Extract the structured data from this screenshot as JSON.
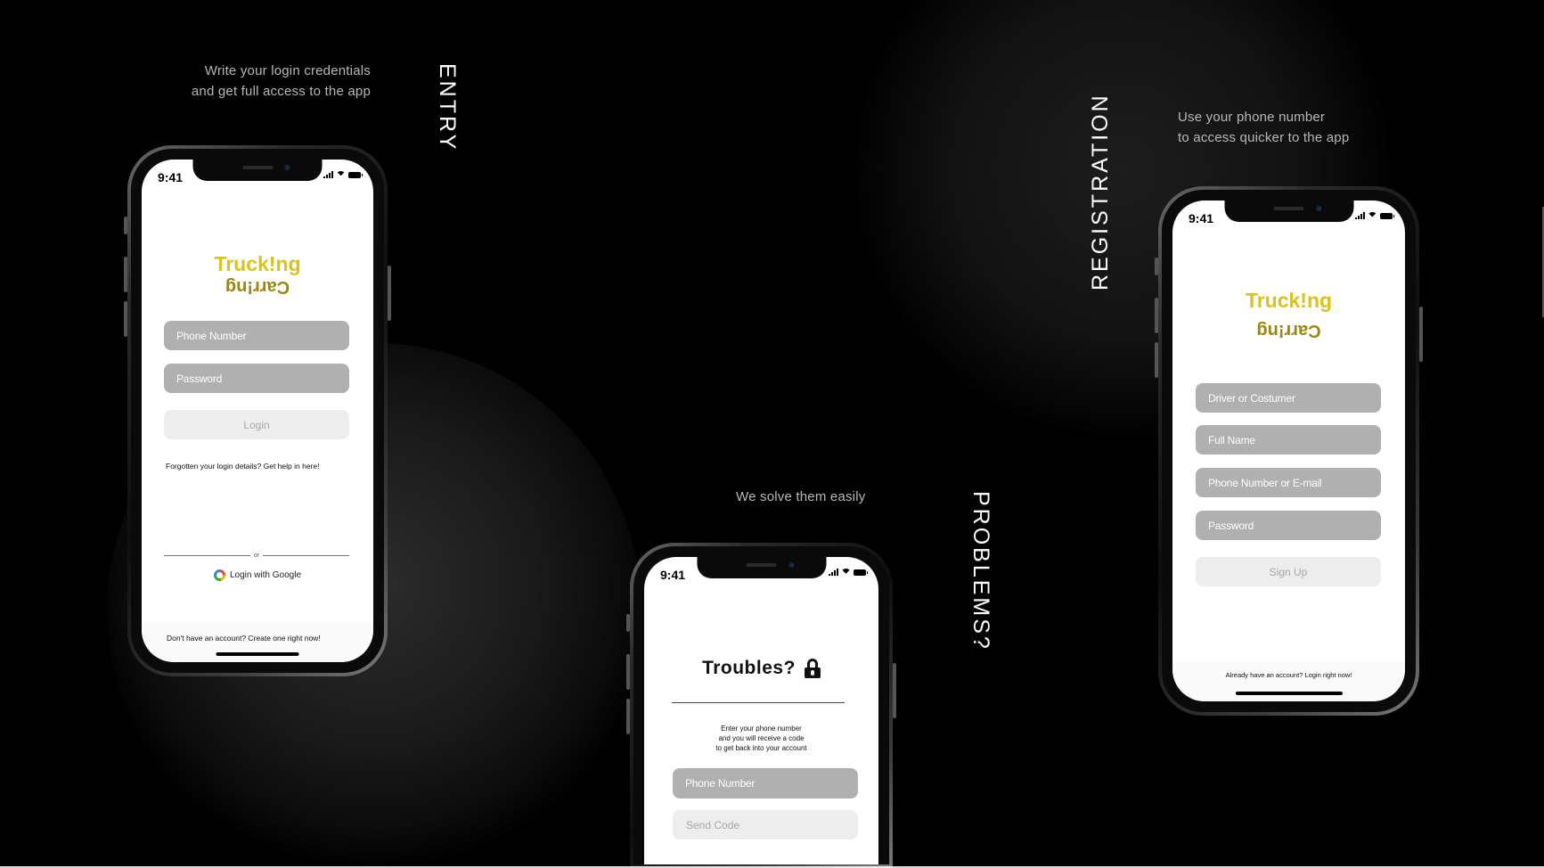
{
  "entry": {
    "caption_line1": "Write your login credentials",
    "caption_line2": "and get full access to the app",
    "label": "ENTRY",
    "time": "9:41",
    "logo_top": "Truck!ng",
    "logo_bottom": "Carr!ng",
    "phone_placeholder": "Phone Number",
    "password_placeholder": "Password",
    "login_button": "Login",
    "forgot_text": "Forgotten your login details? Get help in here!",
    "or_text": "or",
    "google_button": "Login with Google",
    "footer_text": "Don't have an account? Create one right now!"
  },
  "problems": {
    "caption": "We solve them easily",
    "label": "PROBLEMS?",
    "time": "9:41",
    "title": "Troubles?",
    "instr_line1": "Enter your phone number",
    "instr_line2": "and you will receive a code",
    "instr_line3": "to get back into your account",
    "phone_placeholder": "Phone Number",
    "send_code_button": "Send Code"
  },
  "registration": {
    "caption_line1": "Use your phone number",
    "caption_line2": "to access quicker to the app",
    "label": "REGISTRATION",
    "time": "9:41",
    "logo_top": "Truck!ng",
    "logo_bottom": "Carr!ng",
    "role_placeholder": "Driver or Costumer",
    "fullname_placeholder": "Full Name",
    "contact_placeholder": "Phone Number or E-mail",
    "password_placeholder": "Password",
    "signup_button": "Sign Up",
    "footer_text": "Already have an account? Login right now!"
  },
  "colors": {
    "background": "#000000",
    "logo_primary": "#d9c31c",
    "logo_secondary": "#9c8710",
    "field_dark": "#b0b0b0",
    "field_light": "#ededed"
  }
}
